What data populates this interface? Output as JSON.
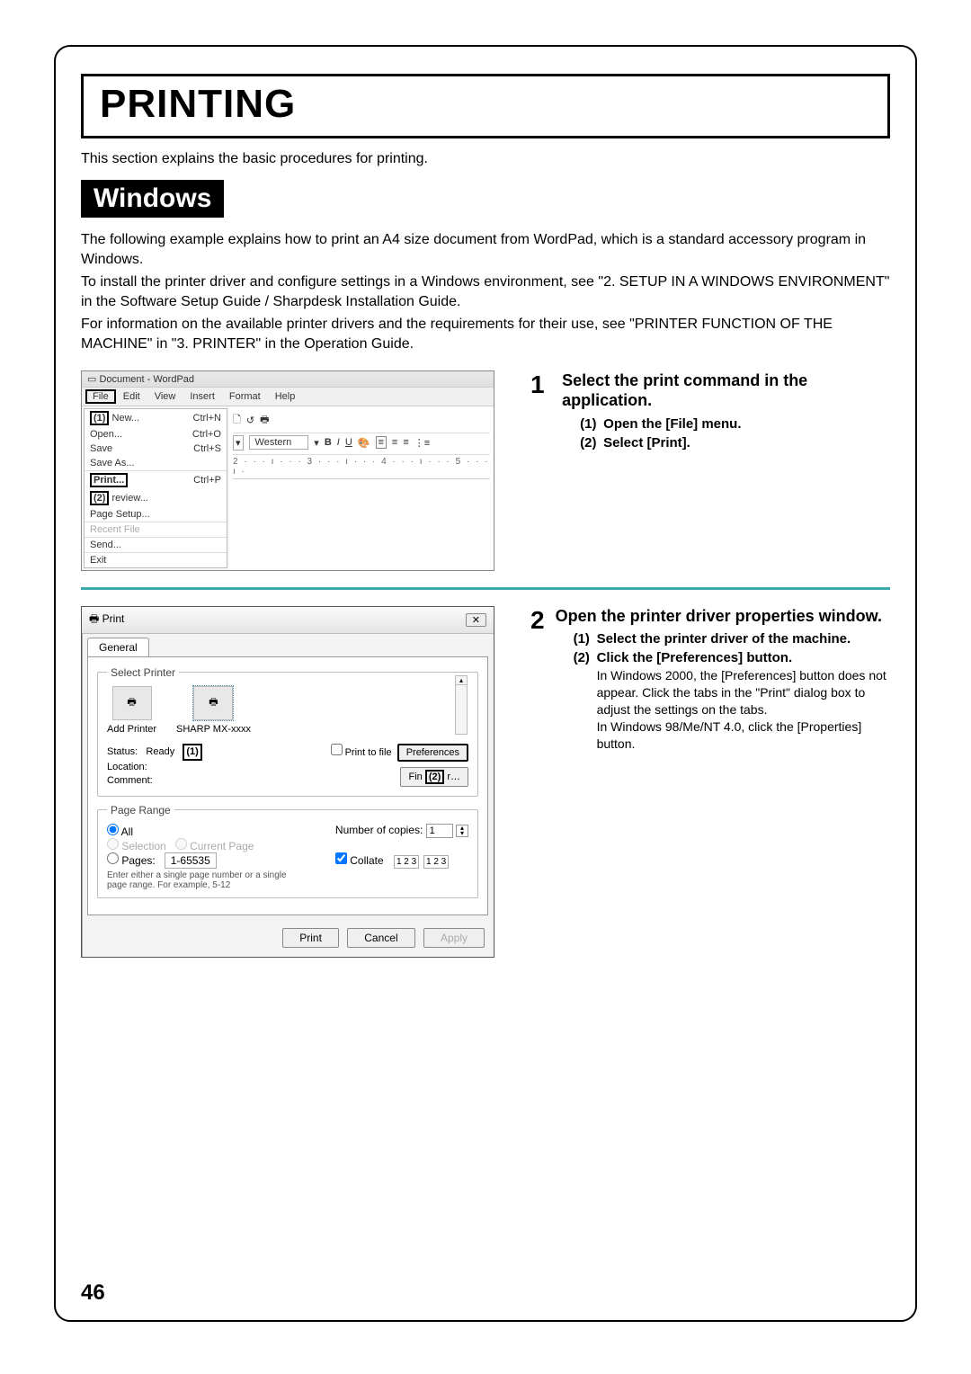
{
  "title": "PRINTING",
  "intro": "This section explains the basic procedures for printing.",
  "windows_label": "Windows",
  "para1": "The following example explains how to print an A4 size document from WordPad, which is a standard accessory program in Windows.",
  "para2": "To install the printer driver and configure settings in a Windows environment, see \"2. SETUP IN A WINDOWS ENVIRONMENT\" in the Software Setup Guide / Sharpdesk Installation Guide.",
  "para3": "For information on the available printer drivers and the requirements for their use, see \"PRINTER FUNCTION OF THE MACHINE\" in \"3. PRINTER\" in the Operation Guide.",
  "wordpad": {
    "window_title": "Document - WordPad",
    "menus": [
      "File",
      "Edit",
      "View",
      "Insert",
      "Format",
      "Help"
    ],
    "callout1": "(1)",
    "callout2": "(2)",
    "file_menu": [
      {
        "label": "New...",
        "accel": "Ctrl+N"
      },
      {
        "label": "Open...",
        "accel": "Ctrl+O"
      },
      {
        "label": "Save",
        "accel": "Ctrl+S"
      },
      {
        "label": "Save As...",
        "accel": ""
      },
      {
        "label": "Print...",
        "accel": "Ctrl+P",
        "boxed": true
      },
      {
        "label": "review...",
        "accel": "",
        "prefix": "(2)"
      },
      {
        "label": "Page Setup...",
        "accel": ""
      },
      {
        "label": "Recent File",
        "accel": "",
        "disabled": true
      },
      {
        "label": "Send...",
        "accel": ""
      },
      {
        "label": "Exit",
        "accel": ""
      }
    ],
    "font_box": "Western",
    "ruler": "2 · · · ı · · · 3 · · · ı · · · 4 · · · ı · · · 5 · · · ı ·"
  },
  "print_dialog": {
    "title": "Print",
    "close": "✕",
    "tab": "General",
    "select_printer_legend": "Select Printer",
    "printers": [
      {
        "name": "Add Printer"
      },
      {
        "name": "SHARP MX-xxxx",
        "selected": true
      }
    ],
    "status_label": "Status:",
    "status_value": "Ready",
    "location_label": "Location:",
    "comment_label": "Comment:",
    "callout1": "(1)",
    "print_to_file": "Print to file",
    "preferences": "Preferences",
    "find": "Fin",
    "callout2": "(2)",
    "page_range_legend": "Page Range",
    "all": "All",
    "selection": "Selection",
    "current": "Current Page",
    "pages": "Pages:",
    "pages_value": "1-65535",
    "pages_hint": "Enter either a single page number or a single page range. For example, 5-12",
    "copies_label": "Number of copies:",
    "copies_value": "1",
    "collate": "Collate",
    "collate_icon": "1 2 3",
    "btn_print": "Print",
    "btn_cancel": "Cancel",
    "btn_apply": "Apply"
  },
  "steps": {
    "s1": {
      "num": "1",
      "title": "Select the print command in the application.",
      "sub1_n": "(1)",
      "sub1": "Open the [File] menu.",
      "sub2_n": "(2)",
      "sub2": "Select [Print]."
    },
    "s2": {
      "num": "2",
      "title": "Open the printer driver properties window.",
      "sub1_n": "(1)",
      "sub1": "Select the printer driver of the machine.",
      "sub2_n": "(2)",
      "sub2": "Click the [Preferences] button.",
      "note1": "In Windows 2000, the [Preferences] button does not appear. Click the tabs in the \"Print\" dialog box to adjust the settings on the tabs.",
      "note2": "In Windows 98/Me/NT 4.0, click the [Properties] button."
    }
  },
  "page_number": "46"
}
